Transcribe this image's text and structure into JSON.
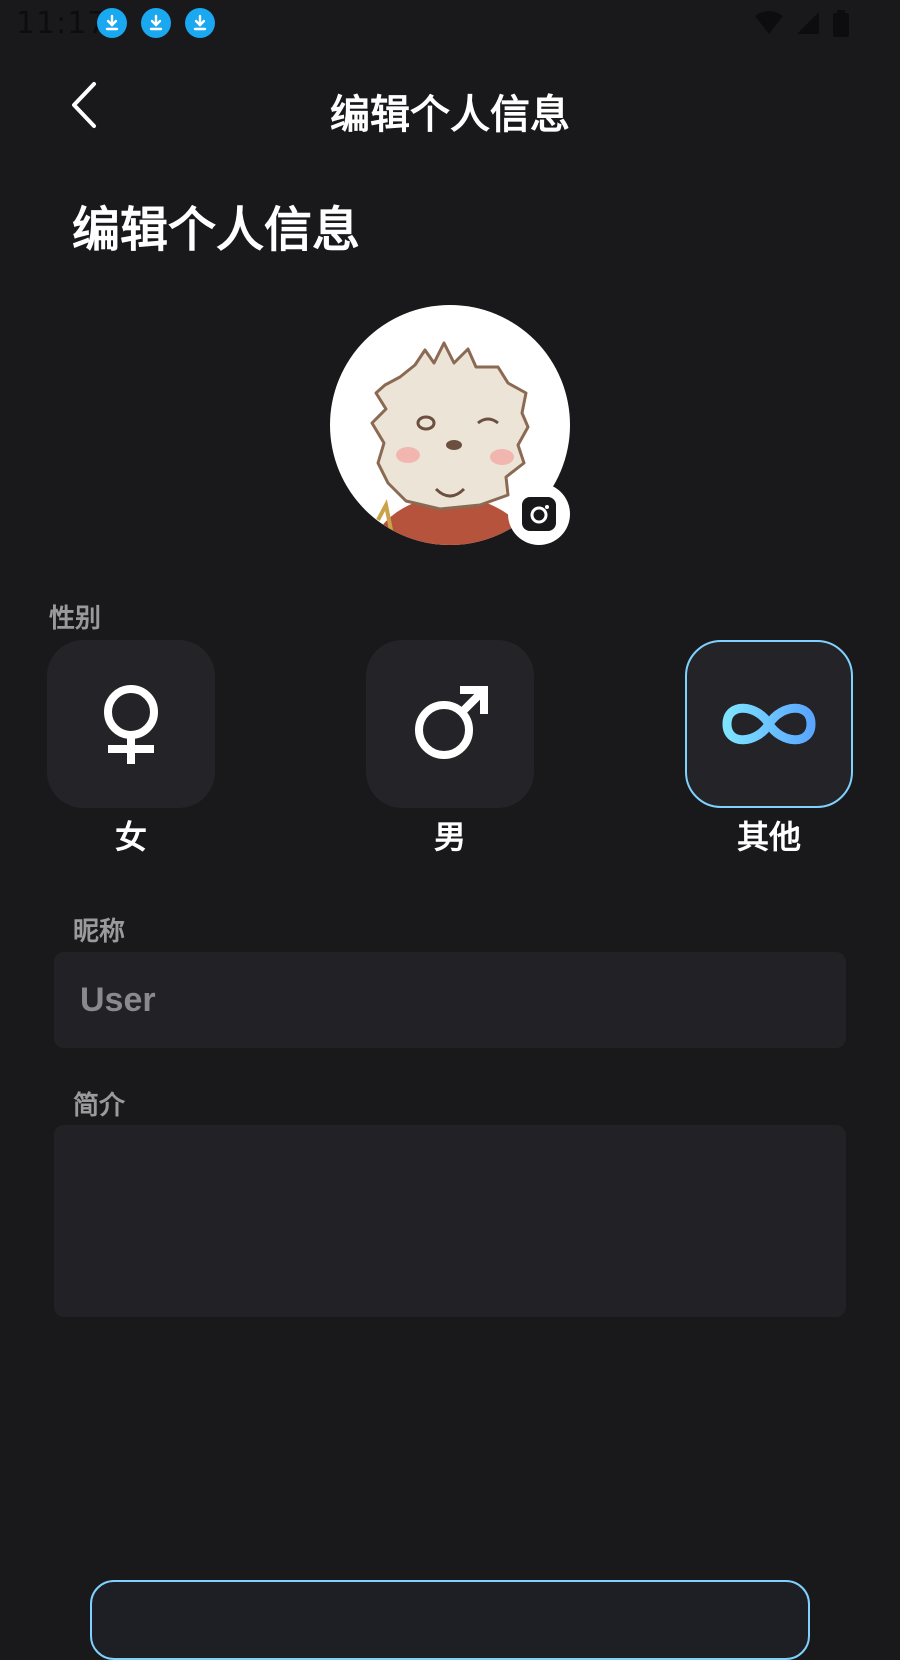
{
  "statusbar": {
    "time": "11:17",
    "icons": [
      "download-notification-icon",
      "download-notification-icon",
      "download-notification-icon",
      "wifi-icon",
      "signal-icon",
      "battery-icon"
    ]
  },
  "header": {
    "title": "编辑个人信息",
    "back_icon": "chevron-left-icon"
  },
  "page": {
    "title": "编辑个人信息"
  },
  "avatar": {
    "camera_icon": "camera-icon"
  },
  "gender": {
    "label": "性别",
    "options": [
      {
        "label": "女",
        "icon": "female-symbol-icon",
        "selected": false
      },
      {
        "label": "男",
        "icon": "male-symbol-icon",
        "selected": false
      },
      {
        "label": "其他",
        "icon": "infinity-icon",
        "selected": true
      }
    ]
  },
  "nickname": {
    "label": "昵称",
    "value": "",
    "placeholder": "User"
  },
  "bio": {
    "label": "简介",
    "value": ""
  },
  "colors": {
    "background": "#19191c",
    "card": "#242428",
    "accent": "#7fd2ff",
    "download_badge": "#1aa8f0"
  }
}
